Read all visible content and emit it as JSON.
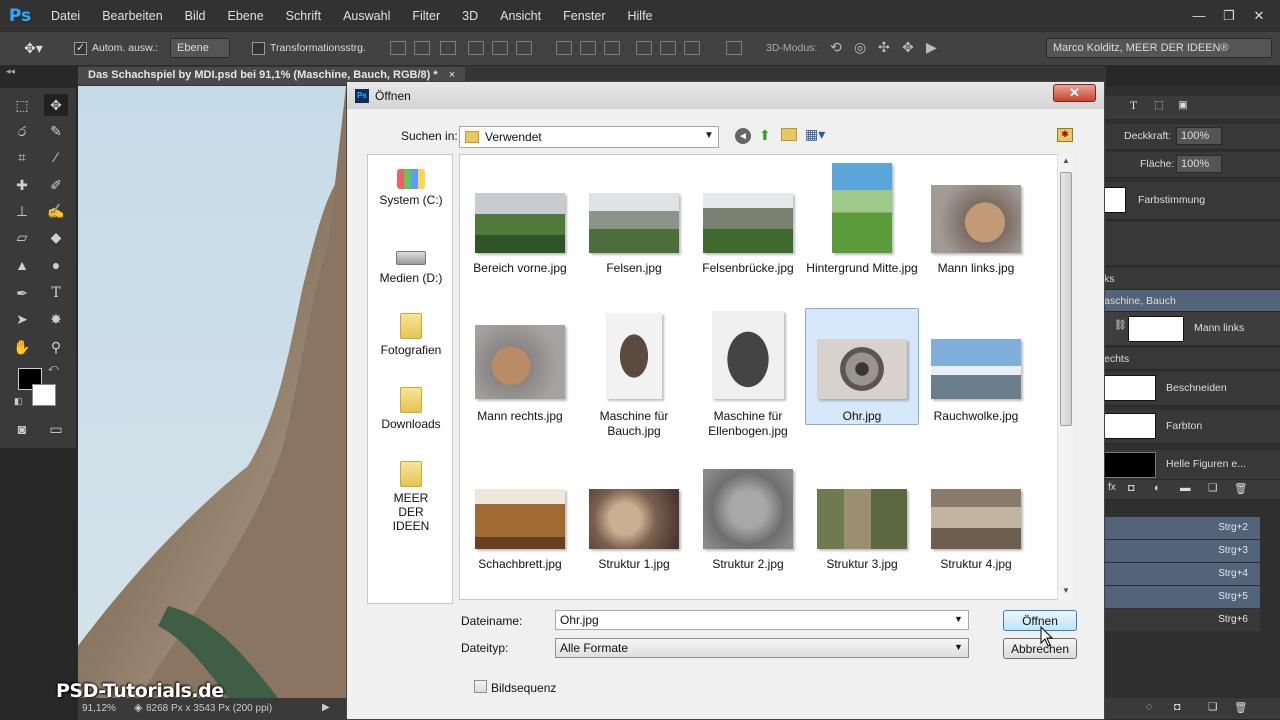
{
  "menubar": {
    "logo": "Ps",
    "items": [
      "Datei",
      "Bearbeiten",
      "Bild",
      "Ebene",
      "Schrift",
      "Auswahl",
      "Filter",
      "3D",
      "Ansicht",
      "Fenster",
      "Hilfe"
    ]
  },
  "optbar": {
    "auto_select_label": "Autom. ausw.:",
    "auto_select_value": "Ebene",
    "transform_label": "Transformationsstrg.",
    "mode3d_label": "3D-Modus:",
    "workspace_value": "Marco Kolditz, MEER DER IDEEN®"
  },
  "document": {
    "tab_title": "Das Schachspiel by MDI.psd bei 91,1% (Maschine, Bauch, RGB/8) *",
    "tab_close": "×",
    "zoom": "91,12%",
    "doc_info": "8268 Px x 3543 Px (200 ppi)"
  },
  "right_panel": {
    "opacity_label": "Deckkraft:",
    "opacity_value": "100%",
    "fill_label": "Fläche:",
    "fill_value": "100%",
    "layer_farbstimmung": "Farbstimmung",
    "group_partial": "ks",
    "group_maschine_bauch": "aschine, Bauch",
    "layer_mann_links": "Mann links",
    "group_rechts": "echts",
    "layer_beschneiden": "Beschneiden",
    "layer_farbton": "Farbton",
    "layer_helle_figuren": "Helle Figuren e...",
    "shortcuts": [
      "Strg+2",
      "Strg+3",
      "Strg+4",
      "Strg+5",
      "Strg+6"
    ]
  },
  "dialog": {
    "title": "Öffnen",
    "close": "✕",
    "look_in_label": "Suchen in:",
    "look_in_value": "Verwendet",
    "places": [
      {
        "label": "System (C:)"
      },
      {
        "label": "Medien (D:)"
      },
      {
        "label": "Fotografien"
      },
      {
        "label": "Downloads"
      },
      {
        "label": "MEER DER IDEEN"
      }
    ],
    "files": [
      "Bereich vorne.jpg",
      "Felsen.jpg",
      "Felsenbrücke.jpg",
      "Hintergrund Mitte.jpg",
      "Mann links.jpg",
      "Mann rechts.jpg",
      "Maschine für Bauch.jpg",
      "Maschine für Ellenbogen.jpg",
      "Ohr.jpg",
      "Rauchwolke.jpg",
      "Schachbrett.jpg",
      "Struktur 1.jpg",
      "Struktur 2.jpg",
      "Struktur 3.jpg",
      "Struktur 4.jpg"
    ],
    "selected_file": "Ohr.jpg",
    "filename_label": "Dateiname:",
    "filename_value": "Ohr.jpg",
    "filetype_label": "Dateityp:",
    "filetype_value": "Alle Formate",
    "open_button": "Öffnen",
    "cancel_button": "Abbrechen",
    "sequence_label": "Bildsequenz"
  },
  "watermark": "PSD-Tutorials.de",
  "colors": {
    "selection_bg": "#d7e8fa",
    "ps_blue": "#31a8ff",
    "close_red": "#c9432c"
  }
}
